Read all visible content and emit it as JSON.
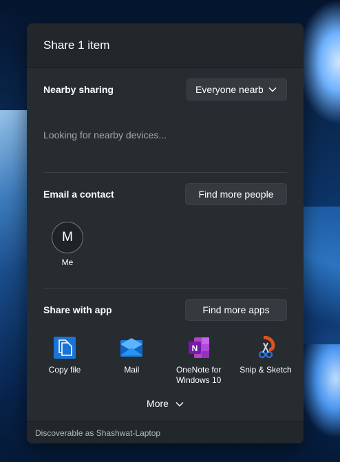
{
  "header": {
    "title": "Share 1 item"
  },
  "nearby": {
    "label": "Nearby sharing",
    "dropdown_value": "Everyone nearby",
    "status": "Looking for nearby devices..."
  },
  "email": {
    "label": "Email a contact",
    "find_button": "Find more people",
    "contacts": [
      {
        "initial": "M",
        "name": "Me"
      }
    ]
  },
  "apps": {
    "label": "Share with app",
    "find_button": "Find more apps",
    "items": [
      {
        "label": "Copy file",
        "icon": "copy-file-icon"
      },
      {
        "label": "Mail",
        "icon": "mail-icon"
      },
      {
        "label": "OneNote for Windows 10",
        "icon": "onenote-icon"
      },
      {
        "label": "Snip & Sketch",
        "icon": "snip-sketch-icon"
      }
    ],
    "more_label": "More"
  },
  "footer": {
    "text": "Discoverable as Shashwat-Laptop"
  },
  "colors": {
    "panel": "#272c31",
    "button": "#353a3f",
    "accent": "#0078d4"
  }
}
